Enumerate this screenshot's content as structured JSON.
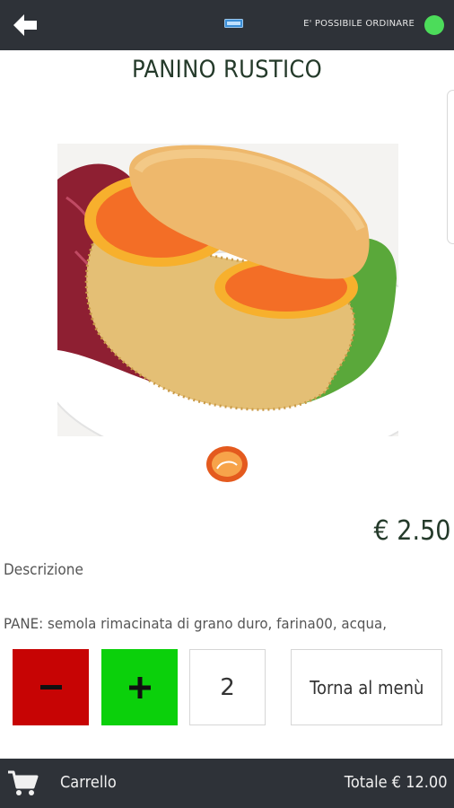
{
  "header": {
    "order_status": "E' POSSIBILE ORDINARE",
    "status_color": "#4cdc5a"
  },
  "product": {
    "title": "PANINO RUSTICO",
    "price": "€ 2.50",
    "description_label": "Descrizione",
    "description_text": "PANE: semola rimacinata di grano duro, farina00, acqua,",
    "image": "sandwich-photo",
    "brand_logo": "godi-logo"
  },
  "controls": {
    "quantity": "2",
    "back_to_menu_label": "Torna al menù",
    "minus_color": "#c70404",
    "plus_color": "#0bd00b"
  },
  "footer": {
    "cart_label": "Carrello",
    "total_label": "Totale € 12.00"
  }
}
